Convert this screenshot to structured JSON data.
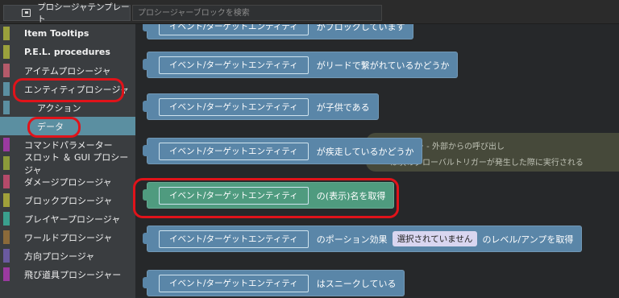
{
  "topbar": {
    "template_button_label": "プロシージャテンプレート",
    "search_placeholder": "プロシージャーブロックを検索"
  },
  "sidebar": {
    "items": [
      {
        "label": "Item Tooltips",
        "color": "#9aa13c"
      },
      {
        "label": "P.E.L. procedures",
        "color": "#9aa13c"
      },
      {
        "label": "アイテムプロシージャ",
        "color": "#b45a6a"
      },
      {
        "label": "エンティティプロシージャ",
        "color": "#5b8fa1"
      },
      {
        "label": "アクション",
        "color": "#5b8fa1"
      },
      {
        "label": "データ",
        "color": "#5b8fa1"
      },
      {
        "label": "コマンドパラメーター",
        "color": "#9a3aa0"
      },
      {
        "label": "スロット ＆ GUI プロシージャ",
        "color": "#8b9a3a"
      },
      {
        "label": "ダメージプロシージャ",
        "color": "#b44a6a"
      },
      {
        "label": "ブロックプロシージャ",
        "color": "#a0a03a"
      },
      {
        "label": "プレイヤープロシージャ",
        "color": "#3aa08e"
      },
      {
        "label": "ワールドプロシージャ",
        "color": "#8b6a3a"
      },
      {
        "label": "方向プロシージャ",
        "color": "#6a5aa0"
      },
      {
        "label": "飛び道具プロシージャー",
        "color": "#9a3aa0"
      }
    ],
    "selected": "データ"
  },
  "tooltip": {
    "line1": "トトリガー - 外部からの呼び出し",
    "line2": "は次のグローバルトリガーが発生した際に実行される"
  },
  "blocks": [
    {
      "chip": "イベント/ターゲットエンティティ",
      "text": "がブロックしています",
      "color": "blue"
    },
    {
      "chip": "イベント/ターゲットエンティティ",
      "text": "がリードで繋がれているかどうか",
      "color": "blue"
    },
    {
      "chip": "イベント/ターゲットエンティティ",
      "text": "が子供である",
      "color": "blue"
    },
    {
      "chip": "イベント/ターゲットエンティティ",
      "text": "が疾走しているかどうか",
      "color": "blue"
    },
    {
      "chip": "イベント/ターゲットエンティティ",
      "text": "の(表示)名を取得",
      "color": "green"
    },
    {
      "chip": "イベント/ターゲットエンティティ",
      "text": "のポーション効果",
      "pill": "選択されていません",
      "text2": "のレベル/アンプを取得",
      "color": "blue"
    },
    {
      "chip": "イベント/ターゲットエンティティ",
      "text": "はスニークしている",
      "color": "blue"
    }
  ],
  "colors": {
    "highlight_ring": "#e0131a",
    "selected_bg": "#5b8fa1"
  }
}
